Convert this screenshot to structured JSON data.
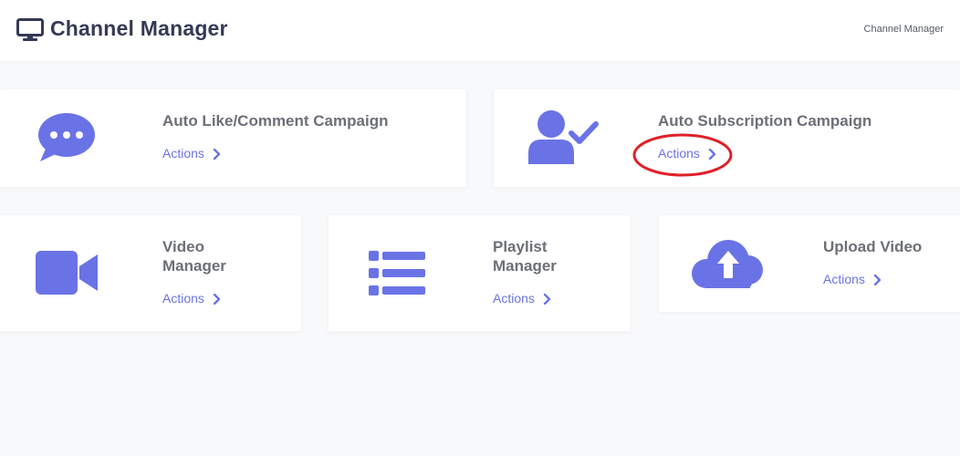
{
  "header": {
    "title": "Channel Manager",
    "breadcrumb": "Channel Manager"
  },
  "colors": {
    "accent": "#6a73e6",
    "title_text": "#343a55",
    "card_title": "#6c6f78",
    "highlight": "#e0202a"
  },
  "cards": [
    {
      "icon": "chat-bubble-icon",
      "title": "Auto Like/Comment Campaign",
      "action_label": "Actions"
    },
    {
      "icon": "user-check-icon",
      "title": "Auto Subscription Campaign",
      "action_label": "Actions",
      "highlighted": true
    },
    {
      "icon": "video-camera-icon",
      "title_line1": "Video",
      "title_line2": "Manager",
      "action_label": "Actions"
    },
    {
      "icon": "list-icon",
      "title_line1": "Playlist",
      "title_line2": "Manager",
      "action_label": "Actions"
    },
    {
      "icon": "cloud-upload-icon",
      "title": "Upload Video",
      "action_label": "Actions"
    }
  ]
}
